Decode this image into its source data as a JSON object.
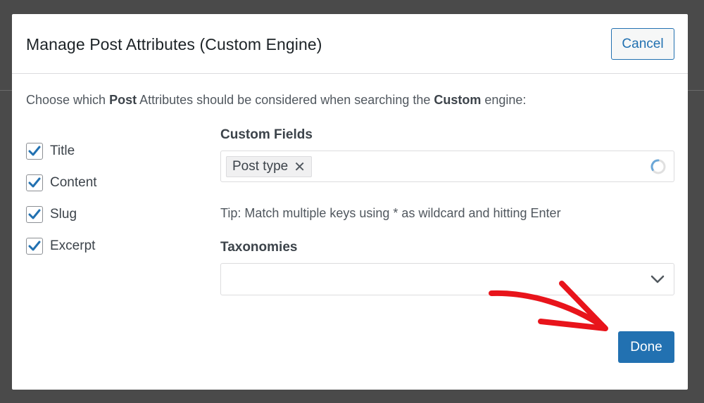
{
  "modal": {
    "title": "Manage Post Attributes (Custom Engine)",
    "cancel_label": "Cancel",
    "done_label": "Done",
    "intro": {
      "part1": "Choose which ",
      "bold1": "Post",
      "part2": " Attributes should be considered when searching the ",
      "bold2": "Custom",
      "part3": " engine:"
    },
    "attributes": [
      {
        "label": "Title",
        "checked": true
      },
      {
        "label": "Content",
        "checked": true
      },
      {
        "label": "Slug",
        "checked": true
      },
      {
        "label": "Excerpt",
        "checked": true
      }
    ],
    "custom_fields": {
      "label": "Custom Fields",
      "tags": [
        "Post type"
      ],
      "tip": "Tip: Match multiple keys using * as wildcard and hitting Enter"
    },
    "taxonomies": {
      "label": "Taxonomies",
      "value": ""
    }
  },
  "colors": {
    "accent": "#2271b1",
    "arrow": "#e8141b"
  }
}
